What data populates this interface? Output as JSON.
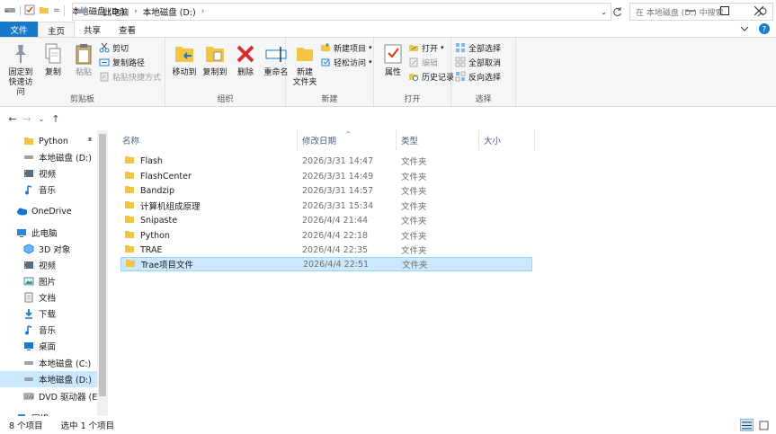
{
  "window": {
    "title": "本地磁盘 (D:)",
    "quick_access_dropdown": "="
  },
  "tabs": [
    {
      "label": "文件"
    },
    {
      "label": "主页"
    },
    {
      "label": "共享"
    },
    {
      "label": "查看"
    }
  ],
  "ribbon": {
    "clipboard": {
      "label": "剪贴板",
      "pin": "固定到\n快速访问",
      "copy": "复制",
      "paste": "粘贴",
      "cut": "剪切",
      "copy_path": "复制路径",
      "paste_shortcut": "粘贴快捷方式"
    },
    "organize": {
      "label": "组织",
      "move_to": "移动到",
      "copy_to": "复制到",
      "delete": "删除",
      "rename": "重命名"
    },
    "new": {
      "label": "新建",
      "new_folder": "新建\n文件夹",
      "new_item": "新建项目",
      "easy_access": "轻松访问"
    },
    "open": {
      "label": "打开",
      "properties": "属性",
      "open": "打开",
      "edit": "编辑",
      "history": "历史记录"
    },
    "select": {
      "label": "选择",
      "select_all": "全部选择",
      "select_none": "全部取消",
      "invert": "反向选择"
    }
  },
  "address": {
    "crumbs": [
      "此电脑",
      "本地磁盘 (D:)"
    ],
    "search_placeholder": "在 本地磁盘 (D:) 中搜索"
  },
  "sidebar": {
    "items": [
      {
        "label": "Python",
        "icon": "folder-icon"
      },
      {
        "label": "本地磁盘 (D:)",
        "icon": "drive-icon"
      },
      {
        "label": "视频",
        "icon": "video-icon"
      },
      {
        "label": "音乐",
        "icon": "music-icon"
      },
      {
        "label": "OneDrive",
        "icon": "cloud-icon"
      },
      {
        "label": "此电脑",
        "icon": "computer-icon"
      },
      {
        "label": "3D 对象",
        "icon": "cube-icon"
      },
      {
        "label": "视频",
        "icon": "video-icon"
      },
      {
        "label": "图片",
        "icon": "picture-icon"
      },
      {
        "label": "文档",
        "icon": "document-icon"
      },
      {
        "label": "下载",
        "icon": "download-icon"
      },
      {
        "label": "音乐",
        "icon": "music-icon"
      },
      {
        "label": "桌面",
        "icon": "desktop-icon"
      },
      {
        "label": "本地磁盘 (C:)",
        "icon": "drive-icon"
      },
      {
        "label": "本地磁盘 (D:)",
        "icon": "drive-icon"
      },
      {
        "label": "DVD 驱动器 (E:)",
        "icon": "dvd-icon"
      },
      {
        "label": "网络",
        "icon": "network-icon"
      }
    ]
  },
  "columns": {
    "name": "名称",
    "date": "修改日期",
    "type": "类型",
    "size": "大小"
  },
  "files": [
    {
      "name": "Flash",
      "date": "2026/3/31 14:47",
      "type": "文件夹"
    },
    {
      "name": "FlashCenter",
      "date": "2026/3/31 14:49",
      "type": "文件夹"
    },
    {
      "name": "Bandzip",
      "date": "2026/3/31 14:57",
      "type": "文件夹"
    },
    {
      "name": "计算机组成原理",
      "date": "2026/3/31 15:34",
      "type": "文件夹"
    },
    {
      "name": "Snipaste",
      "date": "2026/4/4 21:44",
      "type": "文件夹"
    },
    {
      "name": "Python",
      "date": "2026/4/4 22:18",
      "type": "文件夹"
    },
    {
      "name": "TRAE",
      "date": "2026/4/4 22:35",
      "type": "文件夹"
    },
    {
      "name": "Trae项目文件",
      "date": "2026/4/4 22:51",
      "type": "文件夹"
    }
  ],
  "status": {
    "count": "8 个项目",
    "selected": "选中 1 个项目"
  },
  "colors": {
    "accent": "#1979ca",
    "selection": "#cce8ff",
    "folder": "#f4c542"
  }
}
